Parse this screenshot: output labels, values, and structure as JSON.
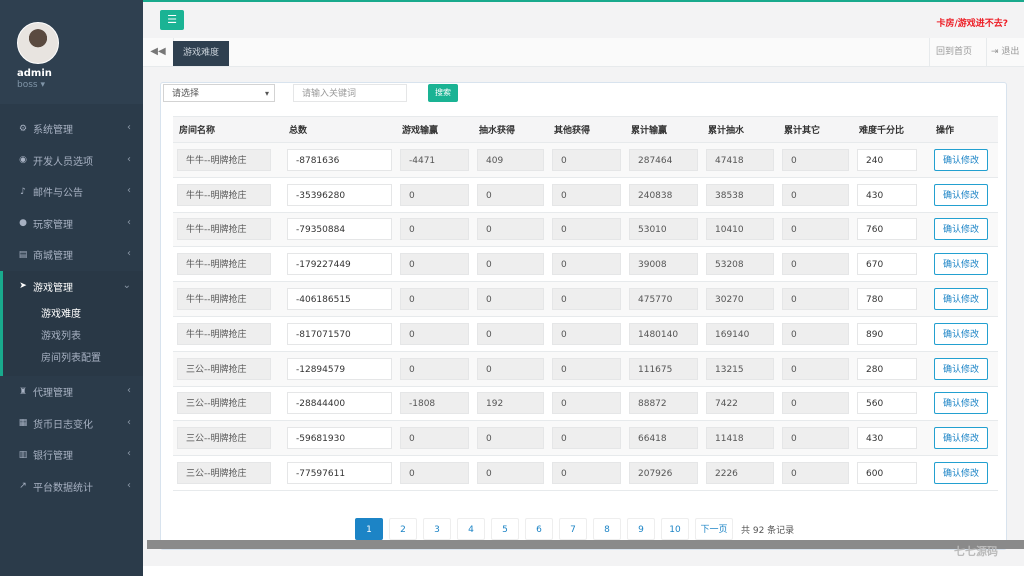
{
  "user": {
    "name": "admin",
    "role": "boss ▾"
  },
  "sidebar": {
    "items": [
      {
        "label": "系统管理",
        "icon": "cogs-icon"
      },
      {
        "label": "开发人员选项",
        "icon": "gamepad-icon"
      },
      {
        "label": "邮件与公告",
        "icon": "bell-icon"
      },
      {
        "label": "玩家管理",
        "icon": "user-icon"
      },
      {
        "label": "商城管理",
        "icon": "shop-icon"
      },
      {
        "label": "游戏管理",
        "icon": "rocket-icon"
      },
      {
        "label": "代理管理",
        "icon": "agent-icon"
      },
      {
        "label": "货币日志变化",
        "icon": "calendar-icon"
      },
      {
        "label": "银行管理",
        "icon": "bank-icon"
      },
      {
        "label": "平台数据统计",
        "icon": "chart-icon"
      }
    ],
    "subitems": [
      "游戏难度",
      "游戏列表",
      "房间列表配置"
    ]
  },
  "header": {
    "notice": "卡房/游戏进不去?"
  },
  "tabs": {
    "active": "游戏难度",
    "home": "回到首页",
    "logout": "退出"
  },
  "filters": {
    "select": "请选择",
    "keyword_placeholder": "请输入关键词",
    "search": "搜索"
  },
  "table": {
    "headers": [
      "房间名称",
      "总数",
      "游戏输赢",
      "抽水获得",
      "其他获得",
      "累计输赢",
      "累计抽水",
      "累计其它",
      "难度千分比",
      "操作"
    ],
    "action_label": "确认修改",
    "rows": [
      [
        "牛牛--明牌抢庄",
        "-8781636",
        "-4471",
        "409",
        "0",
        "287464",
        "47418",
        "0",
        "240"
      ],
      [
        "牛牛--明牌抢庄",
        "-35396280",
        "0",
        "0",
        "0",
        "240838",
        "38538",
        "0",
        "430"
      ],
      [
        "牛牛--明牌抢庄",
        "-79350884",
        "0",
        "0",
        "0",
        "53010",
        "10410",
        "0",
        "760"
      ],
      [
        "牛牛--明牌抢庄",
        "-179227449",
        "0",
        "0",
        "0",
        "39008",
        "53208",
        "0",
        "670"
      ],
      [
        "牛牛--明牌抢庄",
        "-406186515",
        "0",
        "0",
        "0",
        "475770",
        "30270",
        "0",
        "780"
      ],
      [
        "牛牛--明牌抢庄",
        "-817071570",
        "0",
        "0",
        "0",
        "1480140",
        "169140",
        "0",
        "890"
      ],
      [
        "三公--明牌抢庄",
        "-12894579",
        "0",
        "0",
        "0",
        "111675",
        "13215",
        "0",
        "280"
      ],
      [
        "三公--明牌抢庄",
        "-28844400",
        "-1808",
        "192",
        "0",
        "88872",
        "7422",
        "0",
        "560"
      ],
      [
        "三公--明牌抢庄",
        "-59681930",
        "0",
        "0",
        "0",
        "66418",
        "11418",
        "0",
        "430"
      ],
      [
        "三公--明牌抢庄",
        "-77597611",
        "0",
        "0",
        "0",
        "207926",
        "2226",
        "0",
        "600"
      ]
    ]
  },
  "pagination": {
    "pages": [
      "1",
      "2",
      "3",
      "4",
      "5",
      "6",
      "7",
      "8",
      "9",
      "10"
    ],
    "current": "1",
    "next": "下一页",
    "total": "共 92 条记录"
  },
  "watermark": "七七源码"
}
